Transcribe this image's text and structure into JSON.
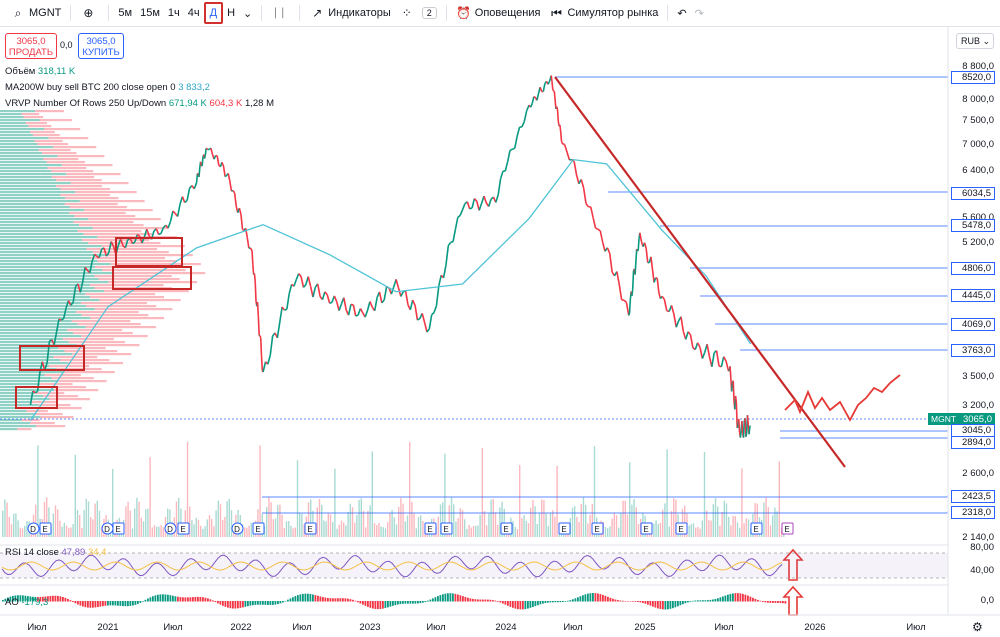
{
  "toolbar": {
    "symbol": "MGNT",
    "add_icon": "plus-circle-icon",
    "intervals": [
      "5м",
      "15м",
      "1ч",
      "4ч",
      "Д",
      "Н"
    ],
    "active_interval": "Д",
    "indicators_label": "Индикаторы",
    "layouts_count": "2",
    "alerts_label": "Оповещения",
    "simulator_label": "Симулятор рынка"
  },
  "trade": {
    "sell_price": "3065,0",
    "sell_label": "ПРОДАТЬ",
    "spread": "0,0",
    "buy_price": "3065,0",
    "buy_label": "КУПИТЬ"
  },
  "legend": {
    "volume_label": "Объём",
    "volume_value": "318,11 K",
    "ma_label": "MA200W buy sell BTC 200 close open 0",
    "ma_value": "3 833,2",
    "vrvp_label": "VRVP Number Of Rows 250 Up/Down",
    "vrvp_up": "671,94 K",
    "vrvp_down": "604,3 K",
    "vrvp_total": "1,28 M"
  },
  "currency": "RUB",
  "price_axis": [
    "8 800,0",
    "8 000,0",
    "7 500,0",
    "7 000,0",
    "6 400,0",
    "6 000,0",
    "5 600,0",
    "5 200,0",
    "4 800,0",
    "4 400,0",
    "4 000,0",
    "3 500,0",
    "3 200,0",
    "2 900,0",
    "2 600,0",
    "2 140,0"
  ],
  "levels": [
    "8520,0",
    "6034,5",
    "5478,0",
    "4806,0",
    "4445,0",
    "4069,0",
    "3763,0",
    "3045,0",
    "2894,0",
    "2423,5",
    "2318,0"
  ],
  "current_price": "3065,0",
  "current_symbol": "MGNT",
  "rsi": {
    "label": "RSI 14 close",
    "value": "47,89",
    "value2": "34,4",
    "axis": [
      "80,00",
      "40,00"
    ]
  },
  "ao": {
    "label": "AO",
    "value": "-179,3",
    "axis": "0,0"
  },
  "x_axis": [
    "Июл",
    "2021",
    "Июл",
    "2022",
    "Июл",
    "2023",
    "Июл",
    "2024",
    "Июл",
    "2025",
    "Июл",
    "2026",
    "Июл"
  ],
  "colors": {
    "up": "#089981",
    "down": "#f23645",
    "ma": "#4fc3d7",
    "level": "#2962ff",
    "annotation": "#c62828",
    "rsi": "#7e57c2"
  },
  "chart_data": {
    "type": "line",
    "title": "MGNT",
    "ylabel": "RUB",
    "ylim": [
      2140,
      8800
    ],
    "series": [
      {
        "name": "MGNT",
        "x": [
          "2020-06",
          "2020-09",
          "2020-12",
          "2021-03",
          "2021-06",
          "2021-09",
          "2021-10",
          "2021-12",
          "2022-02",
          "2022-03",
          "2022-06",
          "2022-09",
          "2022-12",
          "2023-03",
          "2023-06",
          "2023-09",
          "2023-12",
          "2024-03",
          "2024-05",
          "2024-06",
          "2024-09",
          "2024-12",
          "2025-01",
          "2025-03",
          "2025-06",
          "2025-09",
          "2025-10",
          "2025-11"
        ],
        "values": [
          3200,
          4200,
          5000,
          5200,
          5400,
          6200,
          6900,
          6200,
          5000,
          3500,
          4700,
          4400,
          4200,
          4600,
          4000,
          5800,
          5900,
          7800,
          8500,
          7000,
          5500,
          4200,
          5300,
          4400,
          3800,
          3600,
          3000,
          3065
        ]
      },
      {
        "name": "MA200W buy sell BTC 200 close open 0",
        "x": [
          "2020-06",
          "2021-01",
          "2021-09",
          "2022-03",
          "2022-09",
          "2023-03",
          "2023-09",
          "2024-03",
          "2024-07",
          "2024-10",
          "2025-03",
          "2025-07",
          "2025-11"
        ],
        "values": [
          3100,
          4300,
          5100,
          5500,
          5000,
          4500,
          4600,
          5600,
          6600,
          6500,
          5400,
          4700,
          3833.2
        ]
      }
    ],
    "rsi": {
      "name": "RSI 14 close",
      "last": 47.89,
      "signal": 34.4,
      "ylim": [
        20,
        80
      ]
    },
    "ao_last": -179.3,
    "volume_last": 318110
  }
}
